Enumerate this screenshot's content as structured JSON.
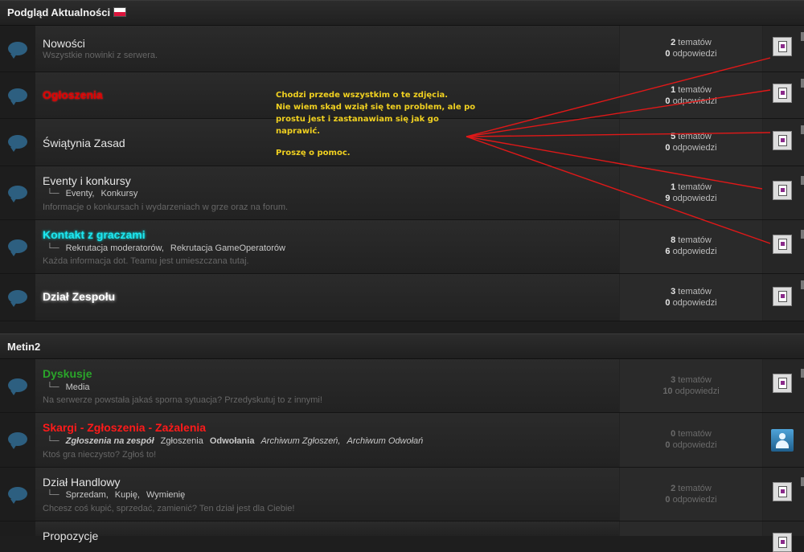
{
  "categories": [
    {
      "title": "Podgląd Aktualności",
      "flag": "poland-flag"
    },
    {
      "title": "Metin2"
    }
  ],
  "forums": [
    {
      "name": "Nowości",
      "desc": "Wszystkie nowinki z serwera.",
      "topics_num": "2",
      "topics_label": "tematów",
      "replies_num": "0",
      "replies_label": "odpowiedzi"
    },
    {
      "name": "Ogłoszenia",
      "desc": "",
      "topics_num": "1",
      "topics_label": "tematów",
      "replies_num": "0",
      "replies_label": "odpowiedzi"
    },
    {
      "name": "Świątynia Zasad",
      "desc": "",
      "topics_num": "5",
      "topics_label": "tematów",
      "replies_num": "0",
      "replies_label": "odpowiedzi"
    },
    {
      "name": "Eventy i konkursy",
      "subforums": [
        "Eventy,",
        "Konkursy"
      ],
      "desc": "Informacje o konkursach i wydarzeniach w grze oraz na forum.",
      "topics_num": "1",
      "topics_label": "tematów",
      "replies_num": "9",
      "replies_label": "odpowiedzi"
    },
    {
      "name": "Kontakt z graczami",
      "subforums": [
        "Rekrutacja moderatorów,",
        "Rekrutacja GameOperatorów"
      ],
      "desc": "Każda informacja dot. Teamu jest umieszczana tutaj.",
      "topics_num": "8",
      "topics_label": "tematów",
      "replies_num": "6",
      "replies_label": "odpowiedzi"
    },
    {
      "name": "Dział Zespołu",
      "desc": "",
      "topics_num": "3",
      "topics_label": "tematów",
      "replies_num": "0",
      "replies_label": "odpowiedzi"
    },
    {
      "name": "Dyskusje",
      "subforums": [
        "Media"
      ],
      "desc": "Na serwerze powstała jakaś sporna sytuacja? Przedyskutuj to z innymi!",
      "topics_num": "3",
      "topics_label": "tematów",
      "replies_num": "10",
      "replies_label": "odpowiedzi"
    },
    {
      "name": "Skargi - Zgłoszenia - Zażalenia",
      "subforums": [
        "Zgłoszenia na zespół",
        "Zgłoszenia",
        "Odwołania",
        "Archiwum Zgłoszeń,",
        "Archiwum Odwołań"
      ],
      "desc": "Ktoś gra nieczysto? Zgłoś to!",
      "topics_num": "0",
      "topics_label": "tematów",
      "replies_num": "0",
      "replies_label": "odpowiedzi"
    },
    {
      "name": "Dział Handlowy",
      "subforums": [
        "Sprzedam,",
        "Kupię,",
        "Wymienię"
      ],
      "desc": "Chcesz coś kupić, sprzedać, zamienić? Ten dział jest dla Ciebie!",
      "topics_num": "2",
      "topics_label": "tematów",
      "replies_num": "0",
      "replies_label": "odpowiedzi"
    },
    {
      "name": "Propozycje"
    }
  ],
  "annotation": {
    "lines": [
      "Chodzi przede wszystkim o te zdjęcia.",
      "Nie wiem skąd wziął się ten problem, ale po",
      "prostu jest i zastanawiam się jak go",
      "naprawić.",
      "",
      "Proszę o pomoc."
    ],
    "color": "#f0d020",
    "arrow_color": "#e01818"
  },
  "icons": {
    "forum": "speech-bubble-icon",
    "last_post": "document-image-icon",
    "avatar": "user-avatar-icon"
  }
}
